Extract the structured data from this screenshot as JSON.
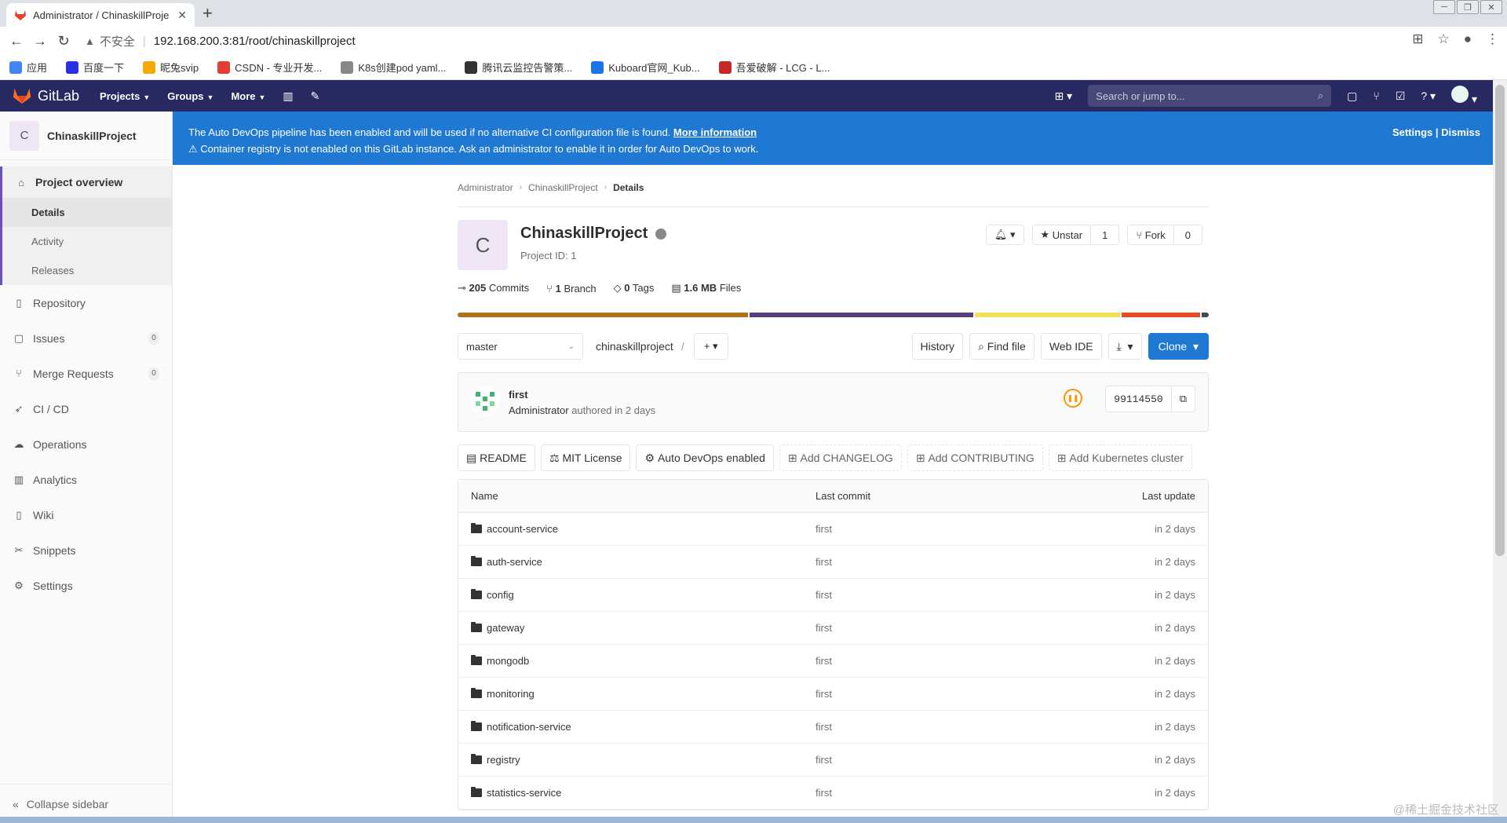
{
  "browser": {
    "tab_title": "Administrator / ChinaskillProje",
    "url_warning": "不安全",
    "url": "192.168.200.3:81/root/chinaskillproject",
    "bookmarks": [
      {
        "label": "应用",
        "color": "#4285f4"
      },
      {
        "label": "百度一下",
        "color": "#2932e1"
      },
      {
        "label": "昵兔svip",
        "color": "#f6a900"
      },
      {
        "label": "CSDN - 专业开发...",
        "color": "#e33e33"
      },
      {
        "label": "K8s创建pod yaml...",
        "color": "#888888"
      },
      {
        "label": "腾讯云监控告警策...",
        "color": "#333333"
      },
      {
        "label": "Kuboard官网_Kub...",
        "color": "#1a73e8"
      },
      {
        "label": "吾爱破解 - LCG - L...",
        "color": "#c62828"
      }
    ]
  },
  "header": {
    "brand": "GitLab",
    "nav": [
      "Projects",
      "Groups",
      "More"
    ],
    "search_placeholder": "Search or jump to..."
  },
  "sidebar": {
    "project_initial": "C",
    "project_name": "ChinaskillProject",
    "overview": "Project overview",
    "overview_items": [
      "Details",
      "Activity",
      "Releases"
    ],
    "items": [
      {
        "label": "Repository",
        "icon": "book-icon"
      },
      {
        "label": "Issues",
        "icon": "issues-icon",
        "count": "0"
      },
      {
        "label": "Merge Requests",
        "icon": "merge-request-icon",
        "count": "0"
      },
      {
        "label": "CI / CD",
        "icon": "rocket-icon"
      },
      {
        "label": "Operations",
        "icon": "cloud-gear-icon"
      },
      {
        "label": "Analytics",
        "icon": "chart-icon"
      },
      {
        "label": "Wiki",
        "icon": "book-icon"
      },
      {
        "label": "Snippets",
        "icon": "scissors-icon"
      },
      {
        "label": "Settings",
        "icon": "gear-icon"
      }
    ],
    "collapse": "Collapse sidebar"
  },
  "banner": {
    "line1": "The Auto DevOps pipeline has been enabled and will be used if no alternative CI configuration file is found.",
    "link": "More information",
    "line2": "Container registry is not enabled on this GitLab instance. Ask an administrator to enable it in order for Auto DevOps to work.",
    "settings": "Settings",
    "dismiss": "Dismiss"
  },
  "breadcrumb": [
    "Administrator",
    "ChinaskillProject",
    "Details"
  ],
  "project": {
    "initial": "C",
    "name": "ChinaskillProject",
    "id_label": "Project ID: 1",
    "unstar": "Unstar",
    "star_count": "1",
    "fork": "Fork",
    "fork_count": "0",
    "commits_num": "205",
    "commits_label": "Commits",
    "branch_num": "1",
    "branch_label": "Branch",
    "tags_num": "0",
    "tags_label": "Tags",
    "files_num": "1.6 MB",
    "files_label": "Files"
  },
  "languages": [
    {
      "share": 39,
      "color": "#b07219"
    },
    {
      "share": 30,
      "color": "#563d7c"
    },
    {
      "share": 19.5,
      "color": "#f1e05a"
    },
    {
      "share": 10.5,
      "color": "#e34c26"
    },
    {
      "share": 1,
      "color": "#384d54"
    }
  ],
  "toolbar": {
    "branch": "master",
    "path": "chinaskillproject",
    "history": "History",
    "find_file": "Find file",
    "web_ide": "Web IDE",
    "clone": "Clone"
  },
  "commit": {
    "message": "first",
    "author": "Administrator",
    "authored": "authored in 2 days",
    "sha": "99114550"
  },
  "badges": {
    "readme": "README",
    "license": "MIT License",
    "autodevops": "Auto DevOps enabled",
    "changelog": "Add CHANGELOG",
    "contributing": "Add CONTRIBUTING",
    "kubernetes": "Add Kubernetes cluster"
  },
  "file_table": {
    "headers": [
      "Name",
      "Last commit",
      "Last update"
    ],
    "rows": [
      {
        "name": "account-service",
        "commit": "first",
        "updated": "in 2 days"
      },
      {
        "name": "auth-service",
        "commit": "first",
        "updated": "in 2 days"
      },
      {
        "name": "config",
        "commit": "first",
        "updated": "in 2 days"
      },
      {
        "name": "gateway",
        "commit": "first",
        "updated": "in 2 days"
      },
      {
        "name": "mongodb",
        "commit": "first",
        "updated": "in 2 days"
      },
      {
        "name": "monitoring",
        "commit": "first",
        "updated": "in 2 days"
      },
      {
        "name": "notification-service",
        "commit": "first",
        "updated": "in 2 days"
      },
      {
        "name": "registry",
        "commit": "first",
        "updated": "in 2 days"
      },
      {
        "name": "statistics-service",
        "commit": "first",
        "updated": "in 2 days"
      }
    ]
  },
  "watermark": "@稀土掘金技术社区"
}
